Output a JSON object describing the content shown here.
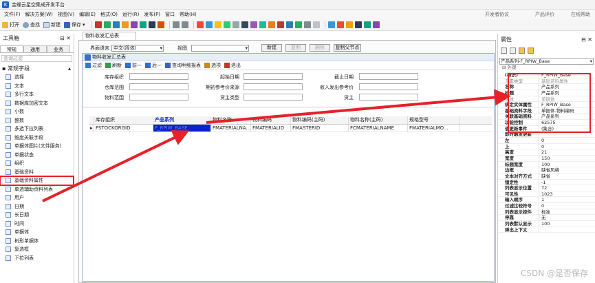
{
  "window": {
    "title": "金蝶云星空集成开发平台"
  },
  "menu": {
    "items": [
      "文件(F)",
      "解决方案(W)",
      "视图(V)",
      "编辑(E)",
      "格式(O)",
      "运行(R)",
      "发布(P)",
      "窗口",
      "帮助(H)"
    ],
    "right": [
      "开发者协议",
      "产品评价",
      "在线帮助"
    ]
  },
  "toolbar": {
    "open": "打开",
    "find": "查找",
    "new": "新建",
    "save": "保存"
  },
  "toolbox": {
    "title": "工具箱",
    "tabs": [
      "常规",
      "通用",
      "业务"
    ],
    "search_placeholder": "查询过滤",
    "group": "常规字段",
    "items": [
      "选择",
      "文本",
      "多行文本",
      "数据库加密文本",
      "小数",
      "整数",
      "多选下拉列表",
      "维度关联字段",
      "单据体图片(文件服务)",
      "单据状态",
      "组织",
      "基础资料",
      "基础资料属性",
      "单选辅助资料列表",
      "用户",
      "日期",
      "长日期",
      "时间",
      "单据体",
      "树形单据体",
      "复选框",
      "下拉列表"
    ],
    "highlighted_index": 12
  },
  "designer": {
    "tab": "物料收发汇总表",
    "lang_label": "界面语言",
    "lang_value": "中文(简体)",
    "view_label": "视图",
    "view_value": "",
    "buttons": {
      "new": "新建",
      "copy": "复制",
      "delete": "删除",
      "copy_parent": "复制父节点"
    },
    "form_title": "物料收发汇总表",
    "form_toolbar": [
      "过滤",
      "刷新",
      "前一",
      "后一",
      "查询明细报表",
      "选项",
      "退出"
    ],
    "filters": [
      "库存组织",
      "起始日期",
      "截止日期",
      "仓库范围",
      "期初参考价来源",
      "收入发出参考价",
      "物料范围",
      "货主类型",
      "货主"
    ],
    "columns": [
      "库存组织",
      "产品系列",
      "物料名称",
      "物料编码",
      "物料编码(主码)",
      "物料名称(主码)",
      "规格型号"
    ],
    "row": [
      "FSTOCKORGID",
      "F_RPIW_BASE",
      "FMATERIALNA...",
      "FMATERIALID",
      "FMASTERID",
      "FCMATERIALNAME",
      "FMATERIALMO..."
    ]
  },
  "properties": {
    "title": "属性",
    "selector": "产品系列-F_RPIW_Base",
    "category": "外观",
    "rows": [
      {
        "k": "(标识)",
        "v": "F_RPIW_Base",
        "gray": false
      },
      {
        "k": "元素类型",
        "v": "基础资料属性",
        "gray": true
      },
      {
        "k": "名称",
        "v": "产品系列",
        "gray": false
      },
      {
        "k": "标题",
        "v": "产品系列",
        "gray": false
      },
      {
        "k": "实体",
        "v": "单据体",
        "gray": true
      },
      {
        "k": "绑定实体属性",
        "v": "F_RPIW_Base",
        "gray": false
      },
      {
        "k": "基础资料字段",
        "v": "单据体.物料编码",
        "gray": false
      },
      {
        "k": "关联基础资料",
        "v": "产品系列",
        "gray": false
      },
      {
        "k": "功能控制",
        "v": "62575",
        "gray": false
      },
      {
        "k": "值更新事件",
        "v": "(集合)",
        "gray": false
      },
      {
        "k": "即时触发更新",
        "v": "",
        "gray": false
      },
      {
        "k": "左",
        "v": "0",
        "gray": false
      },
      {
        "k": "上",
        "v": "0",
        "gray": false
      },
      {
        "k": "高度",
        "v": "21",
        "gray": false
      },
      {
        "k": "宽度",
        "v": "150",
        "gray": false
      },
      {
        "k": "标题宽度",
        "v": "100",
        "gray": false
      },
      {
        "k": "边框",
        "v": "缺省风格",
        "gray": false
      },
      {
        "k": "文本对齐方式",
        "v": "缺省",
        "gray": false
      },
      {
        "k": "锁定性",
        "v": "-1",
        "gray": false
      },
      {
        "k": "列表显示位置",
        "v": "72",
        "gray": false
      },
      {
        "k": "可见性",
        "v": "1023",
        "gray": false
      },
      {
        "k": "输入顺序",
        "v": "1",
        "gray": false
      },
      {
        "k": "过滤比较符号",
        "v": "0",
        "gray": false
      },
      {
        "k": "列表显示控件",
        "v": "标准",
        "gray": false
      },
      {
        "k": "停靠",
        "v": "无",
        "gray": false
      },
      {
        "k": "列表默认显示",
        "v": "100",
        "gray": false
      },
      {
        "k": "弹出上下文",
        "v": "",
        "gray": false
      }
    ]
  },
  "watermark": "CSDN @是否保存",
  "colors": {
    "highlight": "#e8202a",
    "selection": "#0a22c9"
  }
}
